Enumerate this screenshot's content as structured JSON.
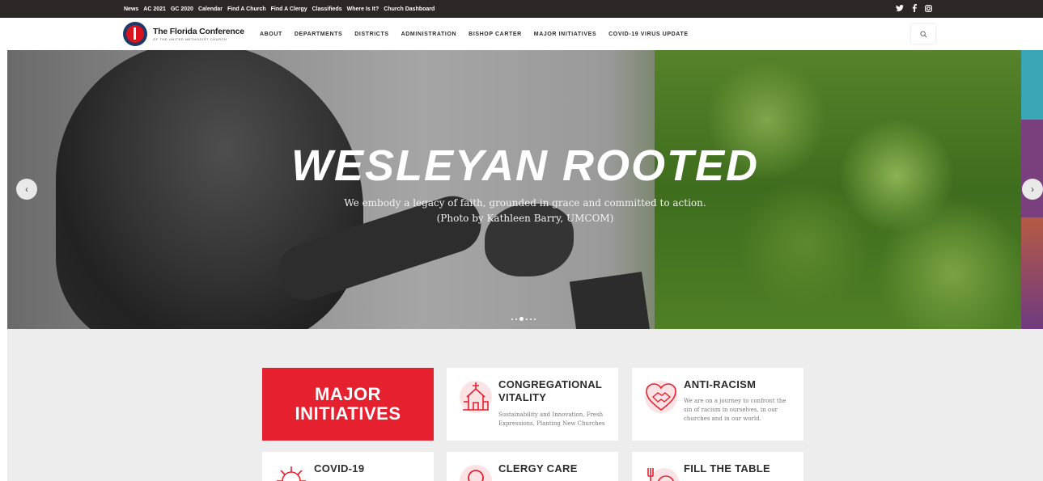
{
  "topbar": {
    "links": [
      "News",
      "AC 2021",
      "GC 2020",
      "Calendar",
      "Find A Church",
      "Find A Clergy",
      "Classifieds",
      "Where Is It?",
      "Church Dashboard"
    ],
    "social": {
      "twitter": "twitter-icon",
      "facebook": "facebook-icon",
      "instagram": "instagram-icon"
    }
  },
  "logo": {
    "name": "The Florida Conference",
    "tagline": "OF THE UNITED METHODIST CHURCH"
  },
  "nav": {
    "items": [
      "ABOUT",
      "DEPARTMENTS",
      "DISTRICTS",
      "ADMINISTRATION",
      "BISHOP CARTER",
      "MAJOR INITIATIVES",
      "COVID-19 VIRUS UPDATE"
    ],
    "search_icon": "search-icon"
  },
  "hero": {
    "title": "WESLEYAN ROOTED",
    "subtitle_line1": "We embody a legacy of faith, grounded in grace and committed to action.",
    "subtitle_line2": "(Photo by Kathleen Barry, UMCOM)",
    "slide_count": 6,
    "active_slide": 3
  },
  "cards": {
    "major": {
      "line1": "MAJOR",
      "line2": "INITIATIVES"
    },
    "congregational": {
      "title1": "CONGREGATIONAL",
      "title2": "VITALITY",
      "desc1": "Sustainability and Innovation, Fresh",
      "desc2": "Expressions, Planting New Churches"
    },
    "antiracism": {
      "title": "ANTI-RACISM",
      "desc1": "We are on a journey to confront the",
      "desc2": "sin of racism in ourselves, in our",
      "desc3": "churches and in our world."
    },
    "covid": {
      "title": "COVID-19"
    },
    "clergy": {
      "title": "CLERGY CARE"
    },
    "table": {
      "title": "FILL THE TABLE"
    }
  },
  "colors": {
    "accent": "#e5212f",
    "topbar": "#2b2726",
    "content_bg": "#ededed"
  }
}
